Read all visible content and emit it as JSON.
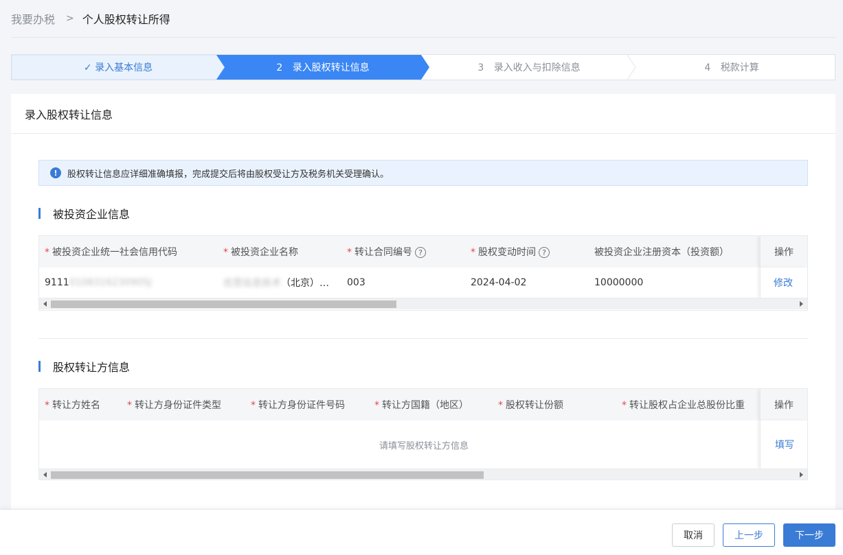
{
  "breadcrumb": {
    "root": "我要办税",
    "separator": ">",
    "current": "个人股权转让所得"
  },
  "steps": [
    {
      "num": "",
      "label": "录入基本信息",
      "state": "done"
    },
    {
      "num": "2",
      "label": "录入股权转让信息",
      "state": "active"
    },
    {
      "num": "3",
      "label": "录入收入与扣除信息",
      "state": "pending"
    },
    {
      "num": "4",
      "label": "税款计算",
      "state": "pending"
    }
  ],
  "card": {
    "title": "录入股权转让信息"
  },
  "notice": {
    "text": "股权转让信息应详细准确填报，完成提交后将由股权受让方及税务机关受理确认。"
  },
  "section1": {
    "title": "被投资企业信息",
    "headers": {
      "credit_code": "被投资企业统一社会信用代码",
      "company_name": "被投资企业名称",
      "contract_no": "转让合同编号",
      "change_date": "股权变动时间",
      "registered_capital": "被投资企业注册资本（投资额）",
      "operation": "操作"
    },
    "row": {
      "credit_code_prefix": "9111",
      "credit_code_rest": "0108316230905J",
      "company_name_blur": "优思信息技术",
      "company_name_suffix": "（北京）…",
      "contract_no": "003",
      "change_date": "2024-04-02",
      "registered_capital": "10000000",
      "action": "修改"
    }
  },
  "section2": {
    "title": "股权转让方信息",
    "headers": {
      "name": "转让方姓名",
      "id_type": "转让方身份证件类型",
      "id_number": "转让方身份证件号码",
      "nationality": "转让方国籍（地区）",
      "share_amount": "股权转让份额",
      "share_ratio": "转让股权占企业总股份比重",
      "operation": "操作"
    },
    "empty_text": "请填写股权转让方信息",
    "action": "填写"
  },
  "footer": {
    "cancel": "取消",
    "prev": "上一步",
    "next": "下一步"
  },
  "colors": {
    "primary": "#3a7bd5",
    "required": "#e5484d",
    "done_step_bg": "#eaf3fd"
  }
}
